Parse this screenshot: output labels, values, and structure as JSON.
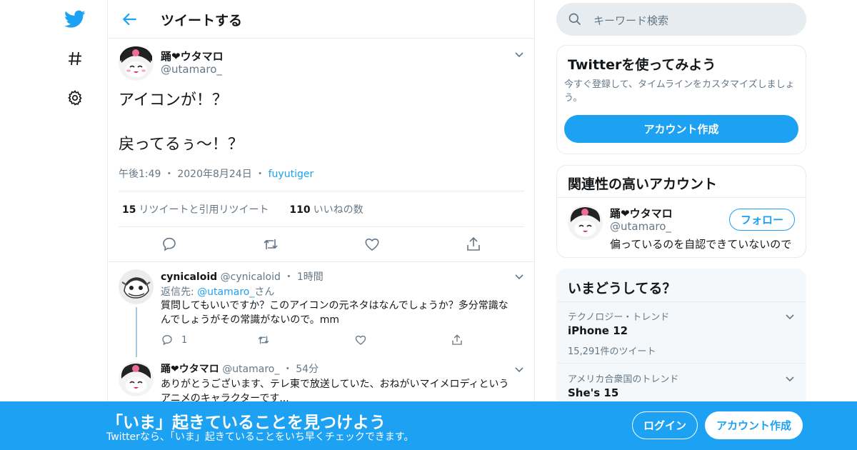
{
  "colors": {
    "accent": "#1da1f2",
    "text": "#14171a",
    "secondary": "#657786",
    "border": "#e6ecf0",
    "heart": "#e0245e"
  },
  "nav": {
    "icons": [
      "twitter-logo-icon",
      "hashtag-icon",
      "gear-icon"
    ]
  },
  "header": {
    "title": "ツイートする",
    "back_icon": "arrow-left-icon"
  },
  "tweet": {
    "display_name": "踊❤ウタマロ",
    "handle": "@utamaro_",
    "text_line1": "アイコンが！？",
    "text_line2": "戻ってるぅ～！？",
    "time": "午後1:49",
    "date": "2020年8月24日",
    "via": "fuyutiger",
    "retweets_count": "15",
    "retweets_label": "リツイートと引用リツイート",
    "likes_count": "110",
    "likes_label": "いいねの数",
    "actions": [
      "reply-icon",
      "retweet-icon",
      "like-icon",
      "share-icon"
    ]
  },
  "replies": [
    {
      "display_name": "cynicaloid",
      "handle": "@cynicaloid",
      "time": "1時間",
      "reply_to_prefix": "返信先: ",
      "reply_to_handle": "@utamaro_",
      "reply_to_suffix": "さん",
      "text": "質問してもいいですか？このアイコンの元ネタはなんでしょうか？多分常識なんでしょうがその常識がないので。mm",
      "reply_count": "1"
    },
    {
      "display_name": "踊❤ウタマロ",
      "handle": "@utamaro_",
      "time": "54分",
      "text": "ありがとうございます、テレ東で放送していた、おねがいマイメロディというアニメのキャラクターです..."
    }
  ],
  "search": {
    "placeholder": "キーワード検索"
  },
  "signup_card": {
    "title": "Twitterを使ってみよう",
    "subtitle": "今すぐ登録して、タイムラインをカスタマイズしましょう。",
    "button": "アカウント作成"
  },
  "related_card": {
    "title": "関連性の高いアカウント",
    "display_name": "踊❤ウタマロ",
    "handle": "@utamaro_",
    "bio": "偏っているのを自認できていないので",
    "follow_button": "フォロー"
  },
  "trends_card": {
    "title": "いまどうしてる？",
    "trends": [
      {
        "context": "テクノロジー・トレンド",
        "name": "iPhone 12",
        "count": "15,291件のツイート"
      },
      {
        "context": "アメリカ合衆国のトレンド",
        "name": "She's 15"
      }
    ]
  },
  "bottom_bar": {
    "title": "「いま」起きていることを見つけよう",
    "subtitle": "Twitterなら、「いま」起きていることをいち早くチェックできます。",
    "login": "ログイン",
    "signup": "アカウント作成"
  }
}
